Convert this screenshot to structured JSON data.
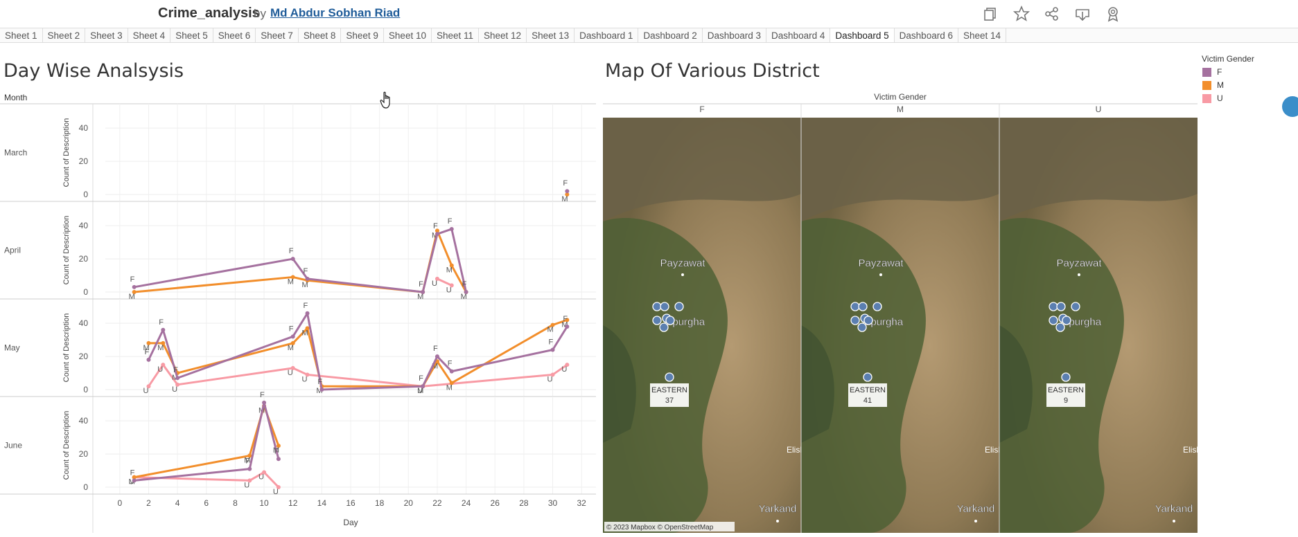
{
  "app": {
    "title": "Crime_analysis",
    "by": "by",
    "author": "Md Abdur Sobhan Riad"
  },
  "toolbar_icons": [
    "copy-icon",
    "star-icon",
    "share-icon",
    "download-icon",
    "badge-icon"
  ],
  "tabs": [
    "Sheet 1",
    "Sheet 2",
    "Sheet 3",
    "Sheet 4",
    "Sheet 5",
    "Sheet 6",
    "Sheet 7",
    "Sheet 8",
    "Sheet 9",
    "Sheet 10",
    "Sheet 11",
    "Sheet 12",
    "Sheet 13",
    "Dashboard 1",
    "Dashboard 2",
    "Dashboard 3",
    "Dashboard 4",
    "Dashboard 5",
    "Dashboard 6",
    "Sheet 14"
  ],
  "active_tab": "Dashboard 5",
  "left_title": "Day Wise Analsysis",
  "right_title": "Map Of Various District",
  "colors": {
    "F": "#a5719f",
    "M": "#f28e2b",
    "U": "#f89aa4"
  },
  "legend": {
    "title": "Victim Gender",
    "items": [
      "F",
      "M",
      "U"
    ]
  },
  "chart_data": [
    {
      "type": "line",
      "row_header": "Month",
      "xlabel": "Day",
      "ylabel": "Count of Description",
      "xticks": [
        0,
        2,
        4,
        6,
        8,
        10,
        12,
        14,
        16,
        18,
        20,
        22,
        24,
        26,
        28,
        30,
        32
      ],
      "xlim": [
        -1,
        33
      ],
      "yticks": [
        0,
        20,
        40
      ],
      "ylim": [
        0,
        48
      ],
      "grid": true,
      "panels": [
        {
          "month": "March",
          "series": [
            {
              "name": "F",
              "points": [
                [
                  31,
                  2
                ]
              ]
            },
            {
              "name": "M",
              "points": [
                [
                  31,
                  0
                ]
              ]
            }
          ]
        },
        {
          "month": "April",
          "series": [
            {
              "name": "F",
              "points": [
                [
                  1,
                  3
                ],
                [
                  12,
                  20
                ],
                [
                  13,
                  8
                ],
                [
                  21,
                  0
                ],
                [
                  22,
                  35
                ],
                [
                  23,
                  38
                ],
                [
                  24,
                  0
                ]
              ]
            },
            {
              "name": "M",
              "points": [
                [
                  1,
                  0
                ],
                [
                  12,
                  9
                ],
                [
                  13,
                  7
                ],
                [
                  21,
                  0
                ],
                [
                  22,
                  37
                ],
                [
                  23,
                  16
                ],
                [
                  24,
                  0
                ]
              ]
            },
            {
              "name": "U",
              "points": [
                [
                  22,
                  8
                ],
                [
                  23,
                  4
                ]
              ]
            }
          ]
        },
        {
          "month": "May",
          "series": [
            {
              "name": "F",
              "points": [
                [
                  2,
                  18
                ],
                [
                  3,
                  36
                ],
                [
                  4,
                  7
                ],
                [
                  12,
                  32
                ],
                [
                  13,
                  46
                ],
                [
                  14,
                  0
                ],
                [
                  21,
                  2
                ],
                [
                  22,
                  20
                ],
                [
                  23,
                  11
                ],
                [
                  30,
                  24
                ],
                [
                  31,
                  38
                ]
              ]
            },
            {
              "name": "M",
              "points": [
                [
                  2,
                  28
                ],
                [
                  3,
                  28
                ],
                [
                  4,
                  10
                ],
                [
                  12,
                  28
                ],
                [
                  13,
                  37
                ],
                [
                  14,
                  2
                ],
                [
                  21,
                  2
                ],
                [
                  22,
                  17
                ],
                [
                  23,
                  4
                ],
                [
                  30,
                  39
                ],
                [
                  31,
                  42
                ]
              ]
            },
            {
              "name": "U",
              "points": [
                [
                  2,
                  2
                ],
                [
                  3,
                  15
                ],
                [
                  4,
                  3
                ],
                [
                  12,
                  13
                ],
                [
                  13,
                  9
                ],
                [
                  21,
                  2
                ],
                [
                  30,
                  9
                ],
                [
                  31,
                  15
                ]
              ]
            }
          ]
        },
        {
          "month": "June",
          "series": [
            {
              "name": "F",
              "points": [
                [
                  1,
                  4
                ],
                [
                  9,
                  11
                ],
                [
                  10,
                  51
                ],
                [
                  11,
                  17
                ]
              ]
            },
            {
              "name": "M",
              "points": [
                [
                  1,
                  6
                ],
                [
                  9,
                  19
                ],
                [
                  10,
                  49
                ],
                [
                  11,
                  25
                ]
              ]
            },
            {
              "name": "U",
              "points": [
                [
                  1,
                  6
                ],
                [
                  9,
                  4
                ],
                [
                  10,
                  9
                ],
                [
                  11,
                  0
                ]
              ]
            }
          ]
        }
      ]
    },
    {
      "type": "map",
      "facet_title": "Victim Gender",
      "facets": [
        "F",
        "M",
        "U"
      ],
      "district_label": "EASTERN",
      "district_values": [
        37,
        41,
        9
      ],
      "place_labels": [
        "Payzawat",
        "opurgha",
        "Yarkand",
        "Elishq"
      ],
      "attribution": "© 2023 Mapbox  © OpenStreetMap"
    }
  ]
}
